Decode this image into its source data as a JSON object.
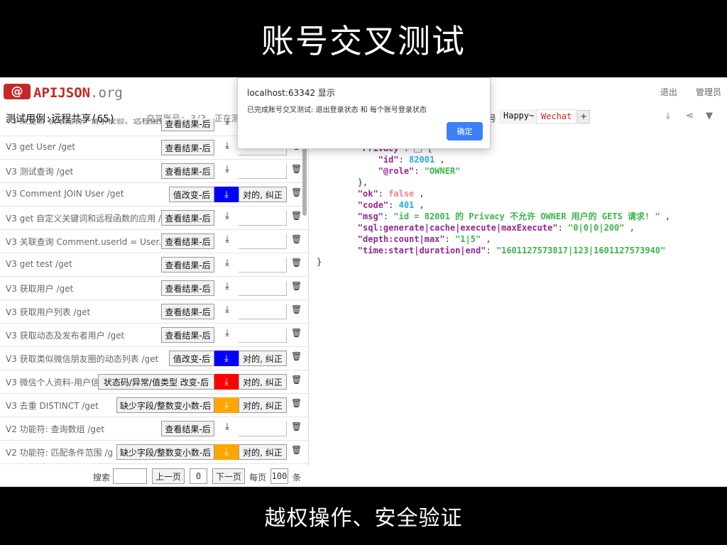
{
  "slide": {
    "title": "账号交叉测试",
    "caption": "越权操作、安全验证"
  },
  "header": {
    "logo_badge": "@",
    "logo_name": "APIJSON",
    "logo_suffix": ".org",
    "logout": "退出",
    "admin": "管理员"
  },
  "subbar": {
    "case_title": "测试用例:远程共享(65)",
    "cross_account": "交叉账号: 3/3",
    "testing": "正在测",
    "account_num": "号",
    "account_happy": "Happy~",
    "account_wechat": "Wechat",
    "add": "+",
    "icons": [
      "download-icon",
      "share-icon",
      "shirt-icon"
    ]
  },
  "rows": [
    {
      "name": "V3 点更新 权限控制、请求校验、远程函数",
      "button": "查看结果-后",
      "kind": "result"
    },
    {
      "name": "V3 get User /get",
      "button": "查看结果-后",
      "kind": "result"
    },
    {
      "name": "V3 测试查询 /get",
      "button": "查看结果-后",
      "kind": "result"
    },
    {
      "name": "V3 Comment JOIN User /get",
      "button": "值改变-后",
      "kind": "change",
      "color": "#0000ff",
      "correct": "对的, 纠正"
    },
    {
      "name": "V3 get 自定义关键词和远程函数的应用 /",
      "button": "查看结果-后",
      "kind": "result"
    },
    {
      "name": "V3 关联查询 Comment.userId = User.",
      "button": "查看结果-后",
      "kind": "result"
    },
    {
      "name": "V3 get test /get",
      "button": "查看结果-后",
      "kind": "result"
    },
    {
      "name": "V3 获取用户 /get",
      "button": "查看结果-后",
      "kind": "result"
    },
    {
      "name": "V3 获取用户列表 /get",
      "button": "查看结果-后",
      "kind": "result"
    },
    {
      "name": "V3 获取动态及发布者用户 /get",
      "button": "查看结果-后",
      "kind": "result"
    },
    {
      "name": "V3 获取类似微信朋友圈的动态列表 /get",
      "button": "值改变-后",
      "kind": "change",
      "color": "#0000ff",
      "correct": "对的, 纠正"
    },
    {
      "name": "V3 微信个人资料-用户信",
      "button": "状态码/异常/值类型 改变-后",
      "kind": "wide1",
      "color": "#ff0000",
      "correct": "对的, 纠正"
    },
    {
      "name": "V3 去重 DISTINCT /get",
      "button": "缺少字段/整数变小数-后",
      "kind": "wide2",
      "color": "#ffa500",
      "correct": "对的, 纠正"
    },
    {
      "name": "V2 功能符: 查询数组 /get",
      "button": "查看结果-后",
      "kind": "result"
    },
    {
      "name": "V2 功能符: 匹配条件范围 /g",
      "button": "缺少字段/整数变小数-后",
      "kind": "wide2",
      "color": "#ffa500",
      "correct": "对的, 纠正"
    }
  ],
  "pager": {
    "search_label": "搜索",
    "search_value": "",
    "prev": "上一页",
    "page": "0",
    "next": "下一页",
    "per_page_label": "每页",
    "per_page": "100",
    "unit": "条"
  },
  "response": {
    "privacy_key": "\"Privacy\"",
    "id_key": "\"id\"",
    "id_val": "82001",
    "role_key": "\"@role\"",
    "role_val": "\"OWNER\"",
    "ok_key": "\"ok\"",
    "ok_val": "false",
    "code_key": "\"code\"",
    "code_val": "401",
    "msg_key": "\"msg\"",
    "msg_val": "\"id = 82001 的 Privacy 不允许 OWNER 用户的 GETS 请求! \"",
    "sql_key": "\"sql:generate|cache|execute|maxExecute\"",
    "sql_val": "\"0|0|0|200\"",
    "depth_key": "\"depth:count|max\"",
    "depth_val": "\"1|5\"",
    "time_key": "\"time:start|duration|end\"",
    "time_val": "\"1601127573817|123|1601127573940\""
  },
  "dialog": {
    "title": "localhost:63342 显示",
    "message": "已完成账号交叉测试: 退出登录状态 和 每个账号登录状态",
    "ok": "确定",
    "ok_color": "#3b82f6"
  }
}
